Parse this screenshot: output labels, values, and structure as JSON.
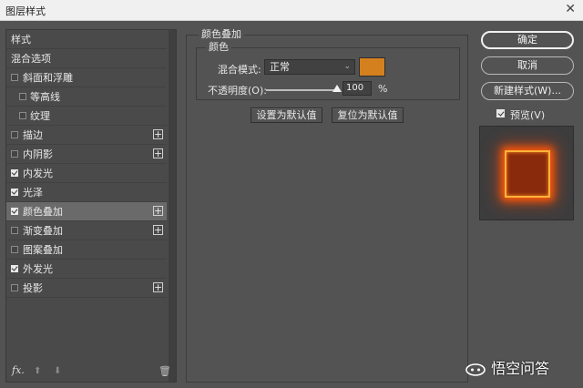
{
  "window": {
    "title": "图层样式",
    "close_glyph": "✕"
  },
  "style_list": {
    "items": [
      {
        "label": "样式",
        "type": "header"
      },
      {
        "label": "混合选项",
        "type": "header"
      },
      {
        "label": "斜面和浮雕",
        "checked": false,
        "plus": false
      },
      {
        "label": "等高线",
        "checked": false,
        "plus": false,
        "indent": true
      },
      {
        "label": "纹理",
        "checked": false,
        "plus": false,
        "indent": true
      },
      {
        "label": "描边",
        "checked": false,
        "plus": true
      },
      {
        "label": "内阴影",
        "checked": false,
        "plus": true
      },
      {
        "label": "内发光",
        "checked": true,
        "plus": false
      },
      {
        "label": "光泽",
        "checked": true,
        "plus": false
      },
      {
        "label": "颜色叠加",
        "checked": true,
        "plus": true,
        "active": true
      },
      {
        "label": "渐变叠加",
        "checked": false,
        "plus": true
      },
      {
        "label": "图案叠加",
        "checked": false,
        "plus": false
      },
      {
        "label": "外发光",
        "checked": true,
        "plus": false
      },
      {
        "label": "投影",
        "checked": false,
        "plus": true
      }
    ],
    "plus_glyph": "+",
    "fx_label": "fx.",
    "up_glyph": "⬆",
    "down_glyph": "⬇",
    "trash_glyph": "🗑"
  },
  "color_overlay": {
    "group_title": "颜色叠加",
    "sub_title": "颜色",
    "blend_mode_label": "混合模式:",
    "blend_mode_value": "正常",
    "caret_glyph": "⌄",
    "overlay_color": "#d4801e",
    "opacity_label": "不透明度(O):",
    "opacity_value": "100",
    "opacity_fraction": 1.0,
    "percent_sign": "%",
    "set_default_label": "设置为默认值",
    "reset_default_label": "复位为默认值"
  },
  "actions": {
    "ok_label": "确定",
    "cancel_label": "取消",
    "new_style_label": "新建样式(W)...",
    "preview_label": "预览(V)",
    "preview_checked": true
  },
  "watermark": {
    "text": "悟空问答"
  },
  "colors": {
    "accent_glow": "#ff5a0a",
    "panel_bg": "#535353"
  }
}
